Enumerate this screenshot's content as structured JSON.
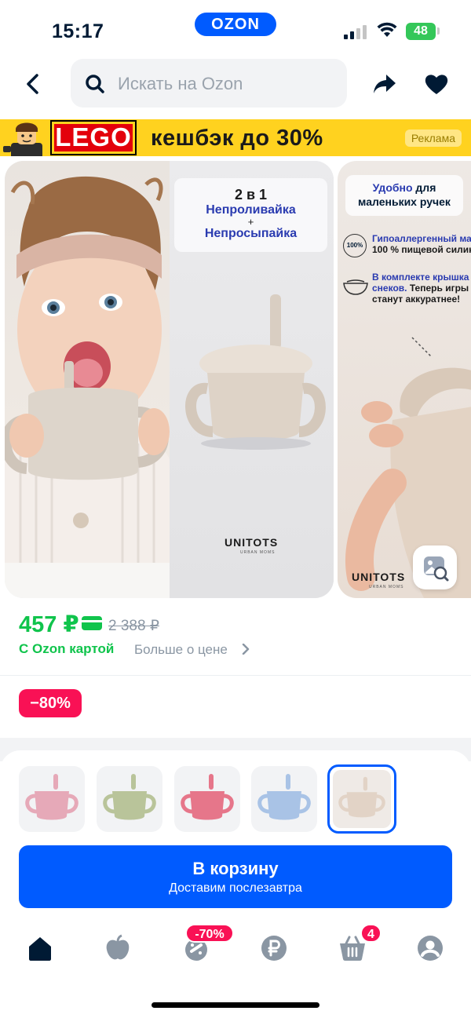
{
  "status_bar": {
    "time": "15:17",
    "app_pill": "OZON",
    "battery": "48"
  },
  "header": {
    "search_placeholder": "Искать на Ozon",
    "icons": [
      "back-arrow-icon",
      "search-icon",
      "share-icon",
      "heart-icon"
    ]
  },
  "banner": {
    "brand": "LEGO",
    "text": "кешбэк до 30%",
    "ad_label": "Реклама",
    "colors": {
      "background": "#ffd21f",
      "brand_bg": "#e3000b"
    }
  },
  "gallery": {
    "slide1": {
      "title": "2 в 1",
      "line1": "Непроливайка",
      "plus": "+",
      "line2": "Непросыпайка",
      "brand": "UNITOTS",
      "brand_sub": "URBAN MOMS"
    },
    "slide2": {
      "title_blue": "Удобно",
      "title_rest": " для",
      "title_line2": "маленьких ручек",
      "badge": "100%",
      "feature1_blue": "Гипоаллергенный ма",
      "feature1_rest": "100 % пищевой силик",
      "feature2_blue": "В комплекте крышка",
      "feature2_mixed_blue": "снеков.",
      "feature2_mixed_rest": " Теперь игры",
      "feature2_line3": "станут аккуратнее!",
      "brand": "UNITOTS",
      "brand_sub": "URBAN MOMS"
    }
  },
  "price": {
    "current": "457 ₽",
    "old": "2 388 ₽",
    "ozon_card_label": "С Ozon картой",
    "more_label": "Больше о цене",
    "color": "#10c44c"
  },
  "discount_badge": "−80%",
  "variants": [
    {
      "color": "#e6a9b8",
      "name": "pink"
    },
    {
      "color": "#b9c49a",
      "name": "olive"
    },
    {
      "color": "#e6768a",
      "name": "rose"
    },
    {
      "color": "#a9c3e6",
      "name": "blue"
    },
    {
      "color": "#e2d3c6",
      "name": "beige",
      "selected": true
    }
  ],
  "cart_button": {
    "label": "В корзину",
    "sublabel": "Доставим послезавтра",
    "color": "#005bff"
  },
  "tab_bar": {
    "tabs": [
      "home-icon",
      "fresh-icon",
      "sale-icon",
      "finance-icon",
      "cart-icon",
      "profile-icon"
    ],
    "sale_badge": "-70%",
    "cart_badge": "4"
  }
}
